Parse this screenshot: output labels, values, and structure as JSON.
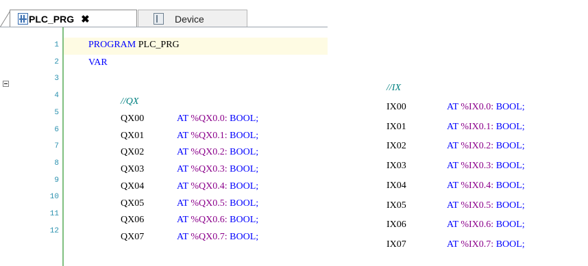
{
  "tabs": [
    {
      "label": "PLC_PRG",
      "close": "✖",
      "icon": "program-icon",
      "active": true
    },
    {
      "label": "Device",
      "icon": "device-icon",
      "active": false
    }
  ],
  "line_numbers": [
    "1",
    "2",
    "3",
    "4",
    "5",
    "6",
    "7",
    "8",
    "9",
    "10",
    "11",
    "12"
  ],
  "code": {
    "program_keyword": "PROGRAM",
    "program_name": "PLC_PRG",
    "var_keyword": "VAR",
    "qx_comment": "//QX",
    "ix_comment": "//IX",
    "at_keyword": "AT",
    "type_bool": "BOOL;",
    "qx_vars": [
      {
        "name": "QX00",
        "address": "%QX0.0:"
      },
      {
        "name": "QX01",
        "address": "%QX0.1:"
      },
      {
        "name": "QX02",
        "address": "%QX0.2:"
      },
      {
        "name": "QX03",
        "address": "%QX0.3:"
      },
      {
        "name": "QX04",
        "address": "%QX0.4:"
      },
      {
        "name": "QX05",
        "address": "%QX0.5:"
      },
      {
        "name": "QX06",
        "address": "%QX0.6:"
      },
      {
        "name": "QX07",
        "address": "%QX0.7:"
      }
    ],
    "ix_vars": [
      {
        "name": "IX00",
        "address": "%IX0.0:"
      },
      {
        "name": "IX01",
        "address": "%IX0.1:"
      },
      {
        "name": "IX02",
        "address": "%IX0.2:"
      },
      {
        "name": "IX03",
        "address": "%IX0.3:"
      },
      {
        "name": "IX04",
        "address": "%IX0.4:"
      },
      {
        "name": "IX05",
        "address": "%IX0.5:"
      },
      {
        "name": "IX06",
        "address": "%IX0.6:"
      },
      {
        "name": "IX07",
        "address": "%IX0.7:"
      }
    ]
  },
  "colors": {
    "keyword": "#0000ff",
    "address": "#8b008b",
    "comment": "#008080",
    "line_number": "#2b91af",
    "current_line": "#fefbe3",
    "gutter_bar": "#7fbf7f"
  }
}
